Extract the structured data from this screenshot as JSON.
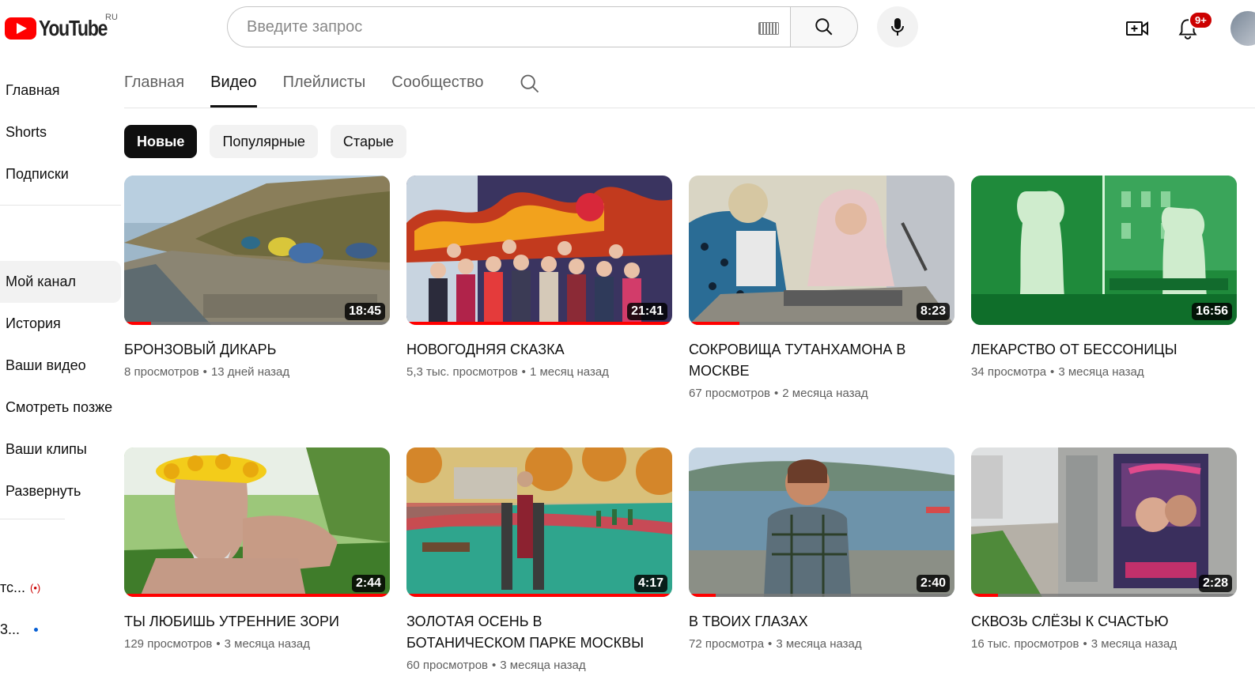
{
  "header": {
    "logo_text": "YouTube",
    "region": "RU",
    "search_placeholder": "Введите запрос",
    "notifications_badge": "9+"
  },
  "sidebar": {
    "items": [
      {
        "label": "Главная",
        "active": false
      },
      {
        "label": "Shorts",
        "active": false
      },
      {
        "label": "Подписки",
        "active": false
      }
    ],
    "you_items": [
      {
        "label": "Мой канал",
        "active": true
      },
      {
        "label": "История",
        "active": false
      },
      {
        "label": "Ваши видео",
        "active": false
      },
      {
        "label": "Смотреть позже",
        "active": false
      },
      {
        "label": "Ваши клипы",
        "active": false
      },
      {
        "label": "Развернуть",
        "active": false
      }
    ],
    "subscriptions": [
      {
        "label": "тс...",
        "indicator": "live"
      },
      {
        "label": "3...",
        "indicator": "new"
      }
    ]
  },
  "tabs": [
    {
      "label": "Главная",
      "active": false
    },
    {
      "label": "Видео",
      "active": true
    },
    {
      "label": "Плейлисты",
      "active": false
    },
    {
      "label": "Сообщество",
      "active": false
    }
  ],
  "chips": [
    {
      "label": "Новые",
      "active": true
    },
    {
      "label": "Популярные",
      "active": false
    },
    {
      "label": "Старые",
      "active": false
    }
  ],
  "videos": [
    {
      "title": "БРОНЗОВЫЙ ДИКАРЬ",
      "views": "8 просмотров",
      "age": "13 дней назад",
      "duration": "18:45",
      "watched": 0.1,
      "scene": "beach"
    },
    {
      "title": "НОВОГОДНЯЯ СКАЗКА",
      "views": "5,3 тыс. просмотров",
      "age": "1 месяц назад",
      "duration": "21:41",
      "watched": 1.0,
      "scene": "dragon"
    },
    {
      "title": "СОКРОВИЩА ТУТАНХАМОНА В МОСКВЕ",
      "views": "67 просмотров",
      "age": "2 месяца назад",
      "duration": "8:23",
      "watched": 0.19,
      "scene": "workshop"
    },
    {
      "title": "ЛЕКАРСТВО ОТ БЕССОНИЦЫ",
      "views": "34 просмотра",
      "age": "3 месяца назад",
      "duration": "16:56",
      "watched": 0,
      "scene": "statues"
    },
    {
      "title": "ТЫ ЛЮБИШЬ УТРЕННИЕ ЗОРИ",
      "views": "129 просмотров",
      "age": "3 месяца назад",
      "duration": "2:44",
      "watched": 1.0,
      "scene": "wreath"
    },
    {
      "title": "ЗОЛОТАЯ ОСЕНЬ В БОТАНИЧЕСКОМ ПАРКЕ МОСКВЫ",
      "views": "60 просмотров",
      "age": "3 месяца назад",
      "duration": "4:17",
      "watched": 1.0,
      "scene": "park"
    },
    {
      "title": "В ТВОИХ ГЛАЗАХ",
      "views": "72 просмотра",
      "age": "3 месяца назад",
      "duration": "2:40",
      "watched": 0.1,
      "scene": "sea"
    },
    {
      "title": "СКВОЗЬ СЛЁЗЫ К СЧАСТЬЮ",
      "views": "16 тыс. просмотров",
      "age": "3 месяца назад",
      "duration": "2:28",
      "watched": 0.1,
      "scene": "busstop"
    }
  ],
  "colors": {
    "accent": "#ff0000",
    "text": "#0f0f0f",
    "secondary": "#606060",
    "chip_bg": "#f2f2f2"
  }
}
